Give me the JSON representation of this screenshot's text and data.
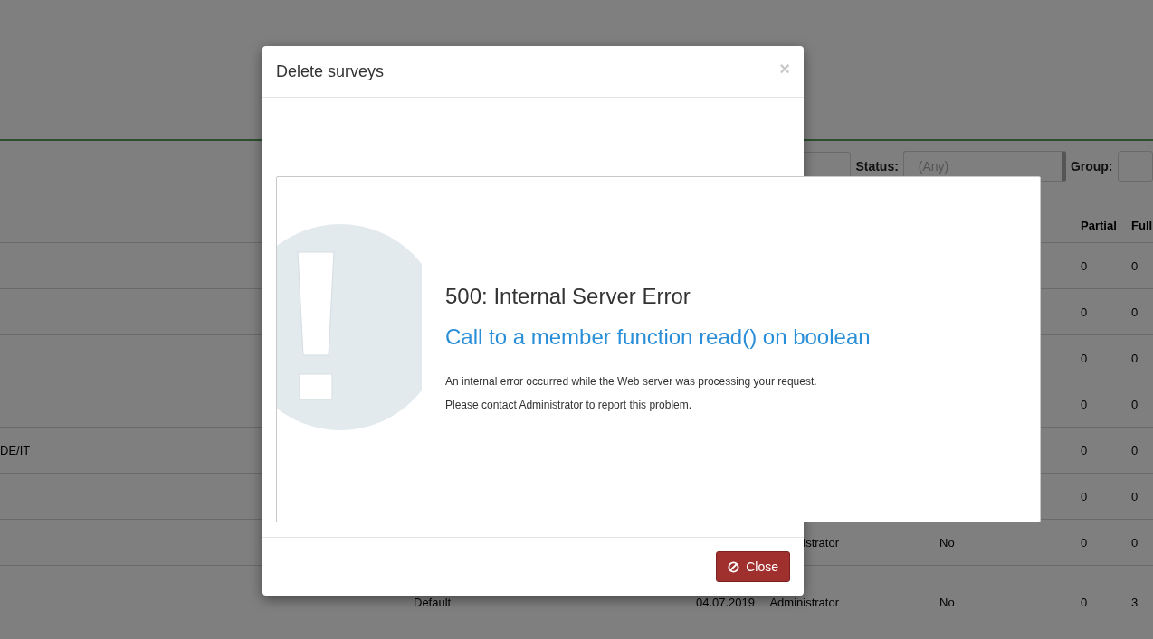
{
  "background": {
    "filters": [
      {
        "label": "Status:",
        "value": "(Any)"
      },
      {
        "label": "Group:"
      }
    ],
    "table": {
      "columns": [
        "Partial",
        "Full"
      ],
      "rows": [
        {
          "partial": "0",
          "full": "0"
        },
        {
          "partial": "0",
          "full": "0"
        },
        {
          "partial": "0",
          "full": "0"
        },
        {
          "partial": "0",
          "full": "0"
        },
        {
          "column_1": "DE/IT",
          "partial": "0",
          "full": "0"
        },
        {
          "partial": "0",
          "full": "0"
        },
        {
          "column_4": "istrator",
          "column_5": "No",
          "partial": "0",
          "full": "0"
        },
        {
          "column_2": "Default",
          "column_3": "04.07.2019",
          "column_4": "Administrator",
          "column_5": "No",
          "partial": "0",
          "full": "3"
        }
      ]
    }
  },
  "modal": {
    "title": "Delete surveys",
    "close_icon": "×",
    "error": {
      "heading": "500: Internal Server Error",
      "message": "Call to a member function read() on boolean",
      "details": [
        "An internal error occurred while the Web server was processing your request.",
        "Please contact Administrator to report this problem."
      ]
    },
    "buttons": [
      {
        "label": "Close",
        "kind": "danger"
      }
    ]
  }
}
